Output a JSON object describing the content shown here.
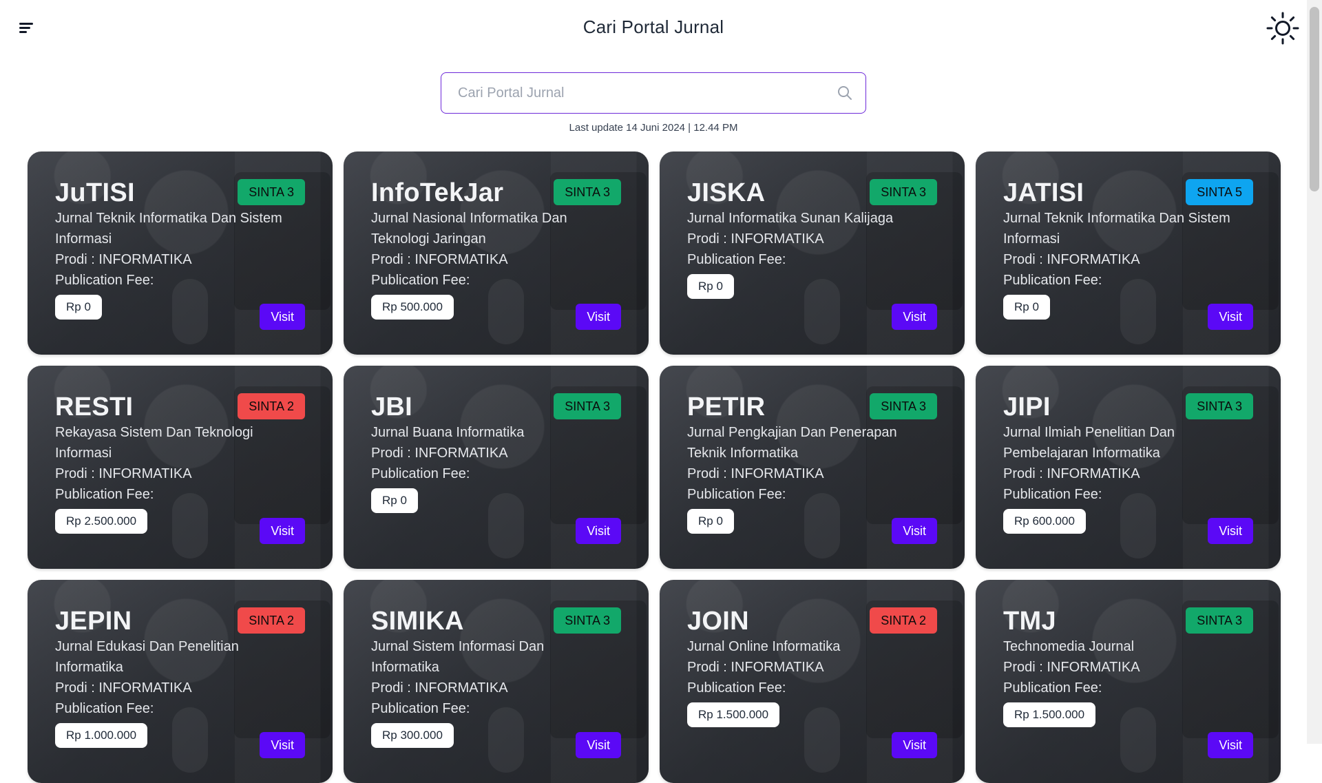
{
  "header": {
    "title": "Cari Portal Jurnal",
    "menu_icon": "hamburger-menu-icon",
    "theme_icon": "sun-icon"
  },
  "search": {
    "placeholder": "Cari Portal Jurnal",
    "value": "",
    "icon": "search-icon"
  },
  "last_update": "Last update 14 Juni 2024 | 12.44 PM",
  "colors": {
    "accent": "#5b09f6",
    "search_border": "#6d28d9",
    "sinta_2": "#f04a4a",
    "sinta_3": "#12a86a",
    "sinta_5": "#0ea5f0"
  },
  "journals": [
    {
      "name": "JuTISI",
      "sinta": "SINTA 3",
      "description": "Jurnal Teknik Informatika Dan Sistem Informasi",
      "prodi": "Prodi : INFORMATIKA",
      "fee_label": "Publication Fee:",
      "fee": "Rp 0",
      "visit": "Visit",
      "badge_color": "#12a86a"
    },
    {
      "name": "InfoTekJar",
      "sinta": "SINTA 3",
      "description": "Jurnal Nasional Informatika Dan Teknologi Jaringan",
      "prodi": "Prodi : INFORMATIKA",
      "fee_label": "Publication Fee:",
      "fee": "Rp 500.000",
      "visit": "Visit",
      "badge_color": "#12a86a"
    },
    {
      "name": "JISKA",
      "sinta": "SINTA 3",
      "description": "Jurnal Informatika Sunan Kalijaga",
      "prodi": "Prodi : INFORMATIKA",
      "fee_label": "Publication Fee:",
      "fee": "Rp 0",
      "visit": "Visit",
      "badge_color": "#12a86a"
    },
    {
      "name": "JATISI",
      "sinta": "SINTA 5",
      "description": "Jurnal Teknik Informatika Dan Sistem Informasi",
      "prodi": "Prodi : INFORMATIKA",
      "fee_label": "Publication Fee:",
      "fee": "Rp 0",
      "visit": "Visit",
      "badge_color": "#0ea5f0"
    },
    {
      "name": "RESTI",
      "sinta": "SINTA 2",
      "description": "Rekayasa Sistem Dan Teknologi Informasi",
      "prodi": "Prodi : INFORMATIKA",
      "fee_label": "Publication Fee:",
      "fee": "Rp 2.500.000",
      "visit": "Visit",
      "badge_color": "#f04a4a"
    },
    {
      "name": "JBI",
      "sinta": "SINTA 3",
      "description": "Jurnal Buana Informatika",
      "prodi": "Prodi : INFORMATIKA",
      "fee_label": "Publication Fee:",
      "fee": "Rp 0",
      "visit": "Visit",
      "badge_color": "#12a86a"
    },
    {
      "name": "PETIR",
      "sinta": "SINTA 3",
      "description": "Jurnal Pengkajian Dan Penerapan Teknik Informatika",
      "prodi": "Prodi : INFORMATIKA",
      "fee_label": "Publication Fee:",
      "fee": "Rp 0",
      "visit": "Visit",
      "badge_color": "#12a86a"
    },
    {
      "name": "JIPI",
      "sinta": "SINTA 3",
      "description": "Jurnal Ilmiah Penelitian Dan Pembelajaran Informatika",
      "prodi": "Prodi : INFORMATIKA",
      "fee_label": "Publication Fee:",
      "fee": "Rp 600.000",
      "visit": "Visit",
      "badge_color": "#12a86a"
    },
    {
      "name": "JEPIN",
      "sinta": "SINTA 2",
      "description": "Jurnal Edukasi Dan Penelitian Informatika",
      "prodi": "Prodi : INFORMATIKA",
      "fee_label": "Publication Fee:",
      "fee": "Rp 1.000.000",
      "visit": "Visit",
      "badge_color": "#f04a4a"
    },
    {
      "name": "SIMIKA",
      "sinta": "SINTA 3",
      "description": "Jurnal Sistem Informasi Dan Informatika",
      "prodi": "Prodi : INFORMATIKA",
      "fee_label": "Publication Fee:",
      "fee": "Rp 300.000",
      "visit": "Visit",
      "badge_color": "#12a86a"
    },
    {
      "name": "JOIN",
      "sinta": "SINTA 2",
      "description": "Jurnal Online Informatika",
      "prodi": "Prodi : INFORMATIKA",
      "fee_label": "Publication Fee:",
      "fee": "Rp 1.500.000",
      "visit": "Visit",
      "badge_color": "#f04a4a"
    },
    {
      "name": "TMJ",
      "sinta": "SINTA 3",
      "description": "Technomedia Journal",
      "prodi": "Prodi : INFORMATIKA",
      "fee_label": "Publication Fee:",
      "fee": "Rp 1.500.000",
      "visit": "Visit",
      "badge_color": "#12a86a"
    }
  ]
}
